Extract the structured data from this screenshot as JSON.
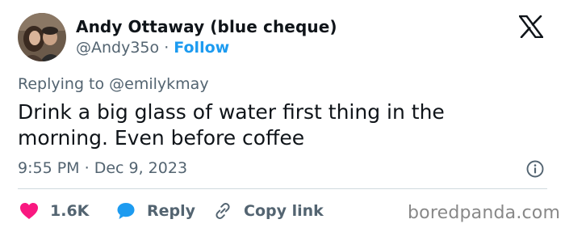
{
  "author": {
    "name": "Andy Ottaway (blue cheque)",
    "handle": "@Andy35o",
    "separator": "·",
    "follow_label": "Follow"
  },
  "reply_context": {
    "prefix": "Replying to",
    "mention": "@emilykmay"
  },
  "tweet": {
    "text_line1": "Drink a big glass of water first thing in the",
    "text_line2": "morning. Even before coffee"
  },
  "meta": {
    "time": "9:55 PM",
    "separator": "·",
    "date": "Dec 9, 2023"
  },
  "actions": {
    "like_count": "1.6K",
    "reply_label": "Reply",
    "copy_label": "Copy link"
  },
  "watermark": "boredpanda.com",
  "colors": {
    "like": "#f91880",
    "reply": "#1d9bf0",
    "follow": "#1d9bf0",
    "muted": "#536471"
  },
  "icons": {
    "platform": "x-logo-icon",
    "info": "info-icon",
    "like": "heart-icon",
    "reply": "speech-bubble-icon",
    "copy": "link-icon"
  }
}
